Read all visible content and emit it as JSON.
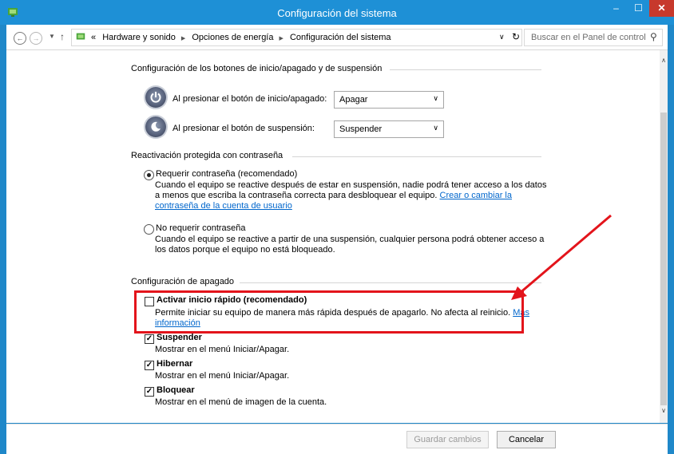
{
  "window": {
    "title": "Configuración del sistema",
    "min_glyph": "–",
    "max_glyph": "☐",
    "close_glyph": "✕"
  },
  "address": {
    "prefix": "«",
    "crumbs": [
      "Hardware y sonido",
      "Opciones de energía",
      "Configuración del sistema"
    ],
    "separator": "▶",
    "search_placeholder": "Buscar en el Panel de control"
  },
  "sections": {
    "buttons": {
      "heading": "Configuración de los botones de inicio/apagado y de suspensión",
      "power_label": "Al presionar el botón de inicio/apagado:",
      "power_value": "Apagar",
      "sleep_label": "Al presionar el botón de suspensión:",
      "sleep_value": "Suspender"
    },
    "password": {
      "heading": "Reactivación protegida con contraseña",
      "require_label": "Requerir contraseña (recomendado)",
      "require_desc_1": "Cuando el equipo se reactive después de estar en suspensión, nadie podrá tener acceso a los datos",
      "require_desc_2": "a menos que escriba la contraseña correcta para desbloquear el equipo.",
      "require_link_1": "Crear o cambiar la",
      "require_link_2": "contraseña de la cuenta de usuario",
      "norequire_label": "No requerir contraseña",
      "norequire_desc_1": "Cuando el equipo se reactive a partir de una suspensión, cualquier persona podrá obtener acceso a",
      "norequire_desc_2": "los datos porque el equipo no está bloqueado."
    },
    "shutdown": {
      "heading": "Configuración de apagado",
      "fast_label": "Activar inicio rápido (recomendado)",
      "fast_desc": "Permite iniciar su equipo de manera más rápida después de apagarlo. No afecta al reinicio.",
      "fast_link_1": "Más",
      "fast_link_2": "información",
      "suspend_label": "Suspender",
      "suspend_desc": "Mostrar en el menú Iniciar/Apagar.",
      "hibernate_label": "Hibernar",
      "hibernate_desc": "Mostrar en el menú Iniciar/Apagar.",
      "lock_label": "Bloquear",
      "lock_desc": "Mostrar en el menú de imagen de la cuenta."
    }
  },
  "footer": {
    "save_label": "Guardar cambios",
    "cancel_label": "Cancelar"
  },
  "colors": {
    "titlebar": "#1e90d6",
    "close": "#c7392c",
    "highlight": "#e3141b",
    "link": "#0066cc"
  }
}
